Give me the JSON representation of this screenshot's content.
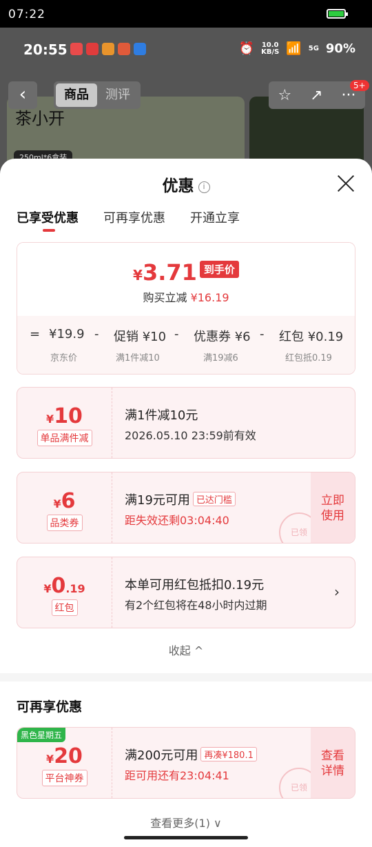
{
  "system": {
    "time": "07:22"
  },
  "phone_status": {
    "clock": "20:55",
    "net_speed_top": "10.0",
    "net_speed_unit": "KB/S",
    "signal": "5G",
    "battery": "90%"
  },
  "product_page": {
    "brand": "茶小开",
    "pack_tag": "250ml*6盒装",
    "tab_goods": "商品",
    "tab_review": "测评",
    "cart_badge": "5+"
  },
  "sheet": {
    "title": "优惠",
    "tabs": [
      "已享受优惠",
      "可再享优惠",
      "开通立享"
    ],
    "summary": {
      "yen": "¥",
      "price": "3.71",
      "price_tag": "到手价",
      "reduce_label": "购买立减",
      "reduce_value": "¥16.19",
      "breakdown": [
        {
          "op": "=",
          "label": "¥19.9",
          "sub": "京东价"
        },
        {
          "op": "-",
          "label": "促销 ¥10",
          "sub": "满1件减10"
        },
        {
          "op": "-",
          "label": "优惠券 ¥6",
          "sub": "满19减6"
        },
        {
          "op": "-",
          "label": "红包 ¥0.19",
          "sub": "红包抵0.19"
        }
      ]
    },
    "coupons": [
      {
        "yen": "¥",
        "amount": "10",
        "kind": "单品满件减",
        "line1": "满1件减10元",
        "line2": "2026.05.10 23:59前有效"
      },
      {
        "yen": "¥",
        "amount": "6",
        "kind": "品类券",
        "line1": "满19元可用",
        "hint": "已达门槛",
        "line2": "距失效还剩03:04:40",
        "side": [
          "立即",
          "使用"
        ],
        "stamp": "已领"
      },
      {
        "yen": "¥",
        "amount": "0",
        "decimal": ".19",
        "kind": "红包",
        "line1": "本单可用红包抵扣0.19元",
        "line2": "有2个红包将在48小时内过期"
      }
    ],
    "collapse_label": "收起 ^",
    "more_section": {
      "title": "可再享优惠",
      "coupon": {
        "tag": "黑色星期五",
        "yen": "¥",
        "amount": "20",
        "kind": "平台神券",
        "line1": "满200元可用",
        "hint": "再凑¥180.1",
        "line2": "距可用还有23:04:41",
        "side": [
          "查看",
          "详情"
        ],
        "stamp": "已领"
      }
    },
    "more_link": "查看更多(1) ∨"
  }
}
